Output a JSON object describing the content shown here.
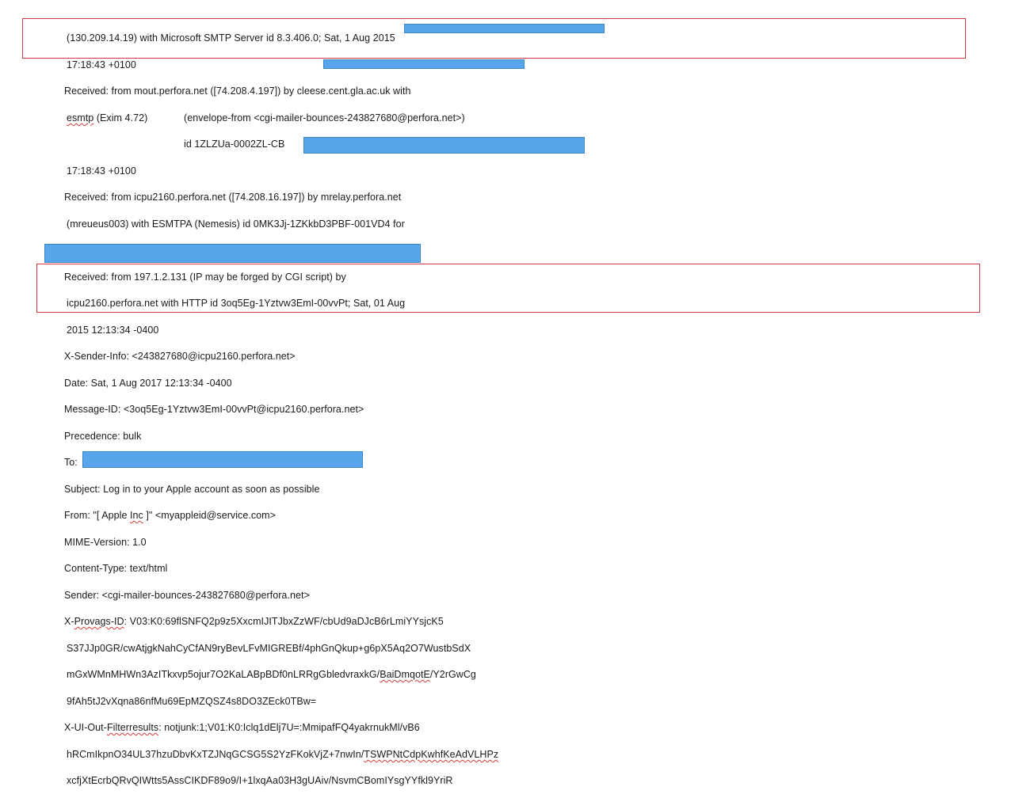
{
  "header_lines": [
    "(130.209.14.19) with Microsoft SMTP Server id 8.3.406.0; Sat, 1 Aug 2015",
    "17:18:43 +0100",
    "Received: from mout.perfora.net ([74.208.4.197]) by cleese.cent.gla.ac.uk with",
    "(Exim 4.72)",
    "(envelope-from <cgi-mailer-bounces-243827680@perfora.net>)",
    "id 1ZLZUa-0002ZL-CB",
    "17:18:43 +0100",
    "Received: from icpu2160.perfora.net ([74.208.16.197]) by mrelay.perfora.net",
    "(mreueus003) with ESMTPA (Nemesis) id 0MK3Jj-1ZKkbD3PBF-001VD4 for",
    "Received: from 197.1.2.131 (IP may be forged by CGI script)    by",
    "icpu2160.perfora.net with HTTP    id 3oq5Eg-1Yztvw3EmI-00vvPt; Sat, 01 Aug",
    "2015 12:13:34 -0400",
    "X-Sender-Info: <243827680@icpu2160.perfora.net>",
    "Date: Sat, 1 Aug 2017 12:13:34 -0400",
    "Message-ID: <3oq5Eg-1Yztvw3EmI-00vvPt@icpu2160.perfora.net>",
    "Precedence: bulk",
    "To:",
    "Subject: Log in to your Apple account as soon as possible",
    "From: \"[ Apple ",
    " ]\" <myappleid@service.com>",
    "MIME-Version: 1.0",
    "Content-Type: text/html",
    "Sender: <cgi-mailer-bounces-243827680@perfora.net>",
    "X-",
    ": V03:K0:69flSNFQ2p9z5XxcmIJITJbxZzWF/cbUd9aDJcB6rLmiYYsjcK5",
    "S37JJp0GR/cwAtjgkNahCyCfAN9ryBevLFvMIGREBf/4phGnQkup+g6pX5Aq2O7WustbSdX",
    "mGxWMnMHWn3AzITkxvp5ojur7O2KaLABpBDf0nLRRgGbledvraxkG/",
    "/Y2rGwCg",
    "9fAh5tJ2vXqna86nfMu69EpMZQSZ4s8DO3ZEck0TBw=",
    "X-UI-Out-",
    ": notjunk:1;V01:K0:Iclq1dElj7U=:MmipafFQ4yakrnukMl/vB6",
    "hRCmIkpnO34UL37hzuDbvKxTZJNqGCSG5S2YzFKokVjZ+7nwIn/",
    "xcfjXtEcrbQRvQIWtts5AssCIKDF89o9/I+1lxqAa03H3gUAiv/NsvmCBomIYsgYYfkl9YriR"
  ],
  "squiggly_words": [
    "esmtp",
    "Inc",
    "Provags-ID",
    "BaiDmqotE",
    "Filterresults",
    "TSWPNtCdpKwhfKeAdVLHPz"
  ],
  "colors": {
    "redaction_fill": "#57a5ea",
    "highlight_border": "#d03a46",
    "spellcheck_underline": "#d63a3a"
  }
}
